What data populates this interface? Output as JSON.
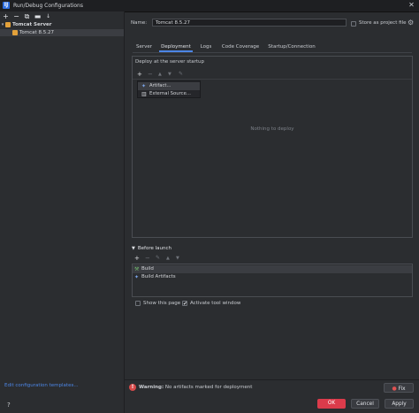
{
  "window": {
    "title": "Run/Debug Configurations",
    "close": "✕"
  },
  "left": {
    "toolbar": [
      "+",
      "−",
      "⧉",
      "▬",
      "↓",
      "↕"
    ],
    "tree": {
      "group": "Tomcat Server",
      "item": "Tomcat 8.5.27"
    },
    "edit_templates_link": "Edit configuration templates...",
    "help": "?"
  },
  "header": {
    "name_label": "Name:",
    "name_value": "Tomcat 8.5.27",
    "store_label": "Store as project file",
    "gear": "⚙"
  },
  "tabs": [
    {
      "label": "Server"
    },
    {
      "label": "Deployment"
    },
    {
      "label": "Logs"
    },
    {
      "label": "Code Coverage"
    },
    {
      "label": "Startup/Connection"
    }
  ],
  "deploy": {
    "title": "Deploy at the server startup",
    "toolbar": [
      "+",
      "−",
      "▲",
      "▼",
      "✎"
    ],
    "popup": [
      "Artifact...",
      "External Source..."
    ],
    "empty_text": "Nothing to deploy"
  },
  "before_launch": {
    "title": "Before launch",
    "toolbar": [
      "+",
      "−",
      "✎",
      "▲",
      "▼"
    ],
    "items": [
      "Build",
      "Build Artifacts"
    ]
  },
  "options": {
    "show_page": "Show this page",
    "activate_tool": "Activate tool window",
    "check": "✔"
  },
  "warning": {
    "icon": "!",
    "bold": "Warning:",
    "text": " No artifacts marked for deployment",
    "fix": "Fix"
  },
  "buttons": {
    "ok": "OK",
    "cancel": "Cancel",
    "apply": "Apply"
  }
}
